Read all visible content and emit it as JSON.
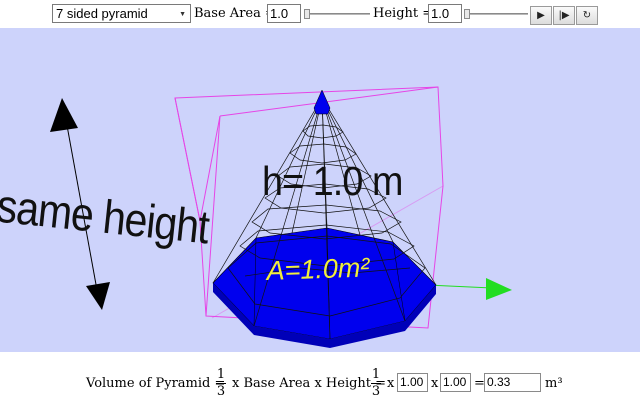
{
  "toolbar": {
    "shape_select": "7 sided pyramid",
    "base_area_label": "Base Area =",
    "base_area_value": "1.0",
    "base_area_slider": 0.0,
    "height_label": "Height =",
    "height_value": "1.0",
    "height_slider": 0.0,
    "play_glyph": "▶",
    "step_glyph": "|▶",
    "reset_glyph": "↻"
  },
  "scene": {
    "side_label": "same height",
    "height_label": "h= 1.0 m",
    "area_label": "A=1.0m²",
    "colors": {
      "background": "#cdd3fb",
      "base_fill": "#0000ee",
      "bounding_box": "#e645e6",
      "wireframe": "#111111",
      "arrow_black": "#000000",
      "arrow_green": "#22dd22"
    }
  },
  "formula": {
    "prefix": "Volume of Pyramid =",
    "frac_num": "1",
    "frac_den": "3",
    "middle": "x Base Area x Height =",
    "frac2_num": "1",
    "frac2_den": "3",
    "times1": "x",
    "area_value": "1.00",
    "times2": "x",
    "height_value": "1.00",
    "equals": "=",
    "volume_value": "0.33",
    "unit": "m³"
  }
}
